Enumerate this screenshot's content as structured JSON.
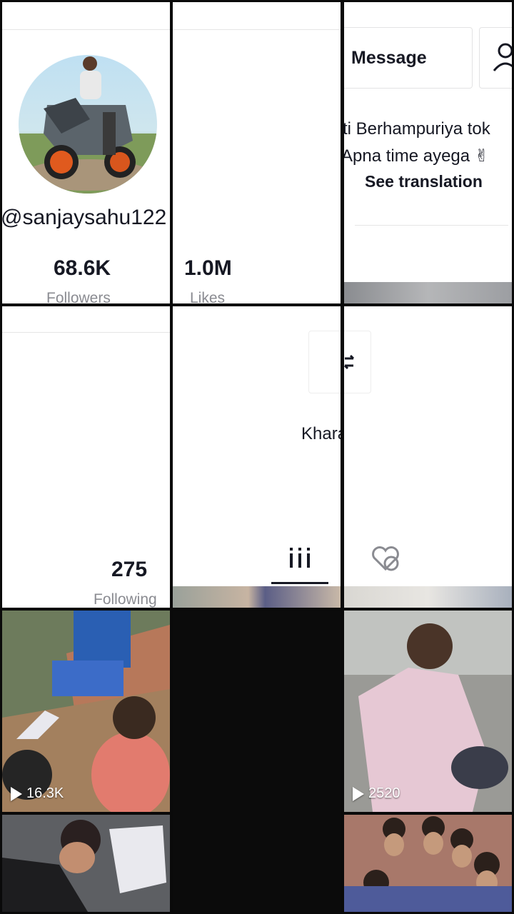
{
  "profile": {
    "username": "@sanjaysahu122",
    "followers_count": "68.6K",
    "followers_label": "Followers",
    "likes_count": "1.0M",
    "likes_label": "Likes",
    "following_count": "275",
    "following_label": "Following",
    "message_button": "Message",
    "bio_line1": "ti Berhampuriya tok",
    "bio_line2": "Apna time ayega ✌",
    "see_translation": "See translation",
    "caption": "Khara 😎"
  },
  "videos": [
    {
      "views": "16.3K"
    },
    {
      "views": "2520"
    }
  ],
  "icons": [
    "profile-person-icon",
    "swap-arrows-icon",
    "grid-icon",
    "liked-hidden-heart-icon",
    "play-icon"
  ]
}
